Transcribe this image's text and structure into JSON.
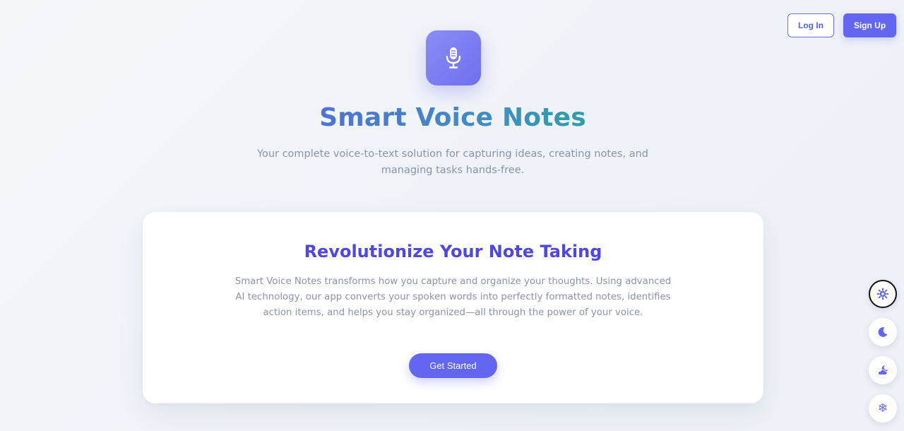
{
  "header": {
    "login_label": "Log In",
    "signup_label": "Sign Up"
  },
  "hero": {
    "logo_icon": "microphone-icon",
    "title": "Smart Voice Notes",
    "subtitle": "Your complete voice-to-text solution for capturing ideas, creating notes, and managing tasks hands-free."
  },
  "card": {
    "title": "Revolutionize Your Note Taking",
    "body": "Smart Voice Notes transforms how you capture and organize your thoughts. Using advanced AI technology, our app converts your spoken words into perfectly formatted notes, identifies action items, and helps you stay organized—all through the power of your voice.",
    "cta_label": "Get Started"
  },
  "theme_switcher": {
    "options": [
      {
        "icon": "sun-icon",
        "active": true
      },
      {
        "icon": "moon-icon",
        "active": false
      },
      {
        "icon": "cloud-moon-icon",
        "active": false
      },
      {
        "icon": "snowflake-icon",
        "active": false
      }
    ]
  },
  "colors": {
    "accent": "#6366f1",
    "title_gradient_start": "#5b5ce6",
    "title_gradient_end": "#10b981",
    "card_title": "#4f46e5",
    "muted_text": "#8a93a8"
  }
}
